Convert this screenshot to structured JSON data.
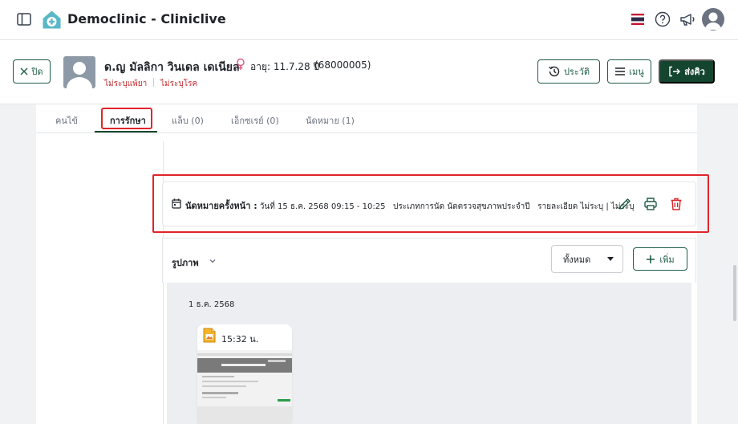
{
  "app": {
    "title": "Democlinic - Cliniclive",
    "language_flag": "th-flag-icon"
  },
  "patient": {
    "close_label": "ปิด",
    "name": "ด.ญ มัลลิกา วินเดล เดเนียล",
    "age": "อายุ: 11.7.28 ปี",
    "hn": "(68000005)",
    "allergy": "ไม่ระบุแพ้ยา",
    "disease": "ไม่ระบุโรค",
    "history_label": "ประวัติ",
    "menu_label": "เมนู",
    "send_label": "ส่งคิว"
  },
  "tabs": [
    {
      "label": "คนไข้",
      "active": false
    },
    {
      "label": "การรักษา",
      "active": true
    },
    {
      "label": "แล็บ (0)",
      "active": false
    },
    {
      "label": "เอ็กซเรย์ (0)",
      "active": false
    },
    {
      "label": "นัดหมาย (1)",
      "active": false
    }
  ],
  "appointment": {
    "title": "นัดหมายครั้งหน้า :",
    "date": "วันที่ 15 ธ.ค. 2568 09:15 - 10:25",
    "type": "ประเภทการนัด นัดตรวจสุขภาพประจำปี",
    "details": "รายละเอียด ไม่ระบุ | ไม่ระบุ"
  },
  "images": {
    "title": "รูปภาพ",
    "filter_value": "ทั้งหมด",
    "add_label": "เพิ่ม",
    "date_group": "1 ธ.ค. 2568",
    "thumb_time": "15:32 น."
  },
  "colors": {
    "primary": "#14452f",
    "highlight": "#e0252b",
    "danger": "#c0282d"
  }
}
